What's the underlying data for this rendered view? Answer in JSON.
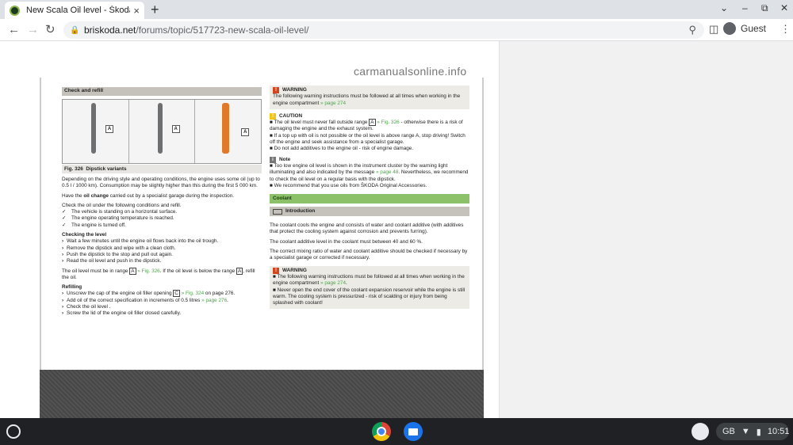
{
  "browser": {
    "tab_title": "New Scala Oil level - Škoda Scal",
    "tab_close": "×",
    "new_tab": "+",
    "url_host": "briskoda.net",
    "url_path": "/forums/topic/517723-new-scala-oil-level/",
    "profile": "Guest",
    "win_minimize": "–",
    "win_restore": "⧉",
    "win_close": "✕",
    "tab_search": "⌄"
  },
  "page": {
    "watermark": "carmanualsonline.info",
    "left": {
      "header": "Check and refill",
      "fig_labels": [
        "A",
        "A",
        "A"
      ],
      "fig_caption_num": "Fig. 326",
      "fig_caption": "Dipstick variants",
      "p1": "Depending on the driving style and operating conditions, the engine uses some oil (up to 0.5 l / 1000 km). Consumption may be slightly higher than this during the first 5 000 km.",
      "p2_pre": "Have the ",
      "p2_bold": "oil change",
      "p2_post": " carried out by a specialist garage during the inspection.",
      "p3": "Check the oil under the following conditions and refill.",
      "checks": [
        "The vehicle is standing on a horizontal surface.",
        "The engine operating temperature is reached.",
        "The engine is turned off."
      ],
      "checking_title": "Checking the level",
      "checking_steps": [
        "Wait a few minutes until the engine oil flows back into the oil trough.",
        "Remove the dipstick and wipe with a clean cloth.",
        "Push the dipstick to the stop and pull out again.",
        "Read the oil level and push in the dipstick."
      ],
      "range_text_pre": "The oil level must be in range ",
      "range_box": "A",
      "range_ref": " » Fig. 326",
      "range_text_post": ". If the oil level is below the range ",
      "range_box2": "A",
      "range_text_end": ", refill the oil.",
      "refilling_title": "Refilling",
      "refill_1_pre": "Unscrew the cap of the engine oil filler opening ",
      "refill_1_box": "C",
      "refill_1_ref": " » Fig. 324",
      "refill_1_post": " on page 276.",
      "refill_2_pre": "Add oil of the correct specification in increments of 0.5 litres ",
      "refill_2_ref": "» page 276",
      "refill_2_post": ".",
      "refill_3": "Check the oil level .",
      "refill_4": "Screw the lid of the engine oil filler closed carefully."
    },
    "right": {
      "warning_title": "WARNING",
      "warning_text": "The following warning instructions must be followed at all times when working in the engine compartment",
      "warning_ref": " » page 274",
      "caution_title": "CAUTION",
      "caution_1_pre": "The oil level must never fall outside range ",
      "caution_1_box": "A",
      "caution_1_ref": " » Fig. 326",
      "caution_1_post": " - otherwise there is a risk of damaging the engine and the exhaust system.",
      "caution_2": "If a top up with oil is not possible or the oil level is above range A, stop driving! Switch off the engine and seek assistance from a specialist garage.",
      "caution_3": "Do not add additives to the engine oil - risk of engine damage.",
      "note_title": "Note",
      "note_1_pre": "Too low engine oil level is shown in the instrument cluster by the warning light illuminating and also indicated by the message ",
      "note_1_ref": "» page 48",
      "note_1_post": ". Nevertheless, we recommend to check the oil level on a regular basis with the dipstick.",
      "note_2": "We recommend that you use oils from ŠKODA Original Accessories.",
      "coolant": "Coolant",
      "intro": "Introduction",
      "c1": "The coolant cools the engine and consists of water and coolant additive (with additives that protect the cooling system against corrosion and prevents furring).",
      "c2": "The coolant additive level in the coolant must between 40 and 60 %.",
      "c3": "The correct mixing ratio of water and coolant additive should be checked if necessary by a specialist garage or corrected if necessary.",
      "warning2_title": "WARNING",
      "warning2_1_pre": "The following warning instructions must be followed at all times when working in the engine compartment ",
      "warning2_1_ref": "» page 274",
      "warning2_1_post": ".",
      "warning2_2": "Never open the end cover of the coolant expansion reservoir while the engine is still warm. The cooling system is pressurized - risk of scalding or injury from being splashed with coolant!"
    }
  },
  "shelf": {
    "lang": "GB",
    "time": "10:51"
  }
}
